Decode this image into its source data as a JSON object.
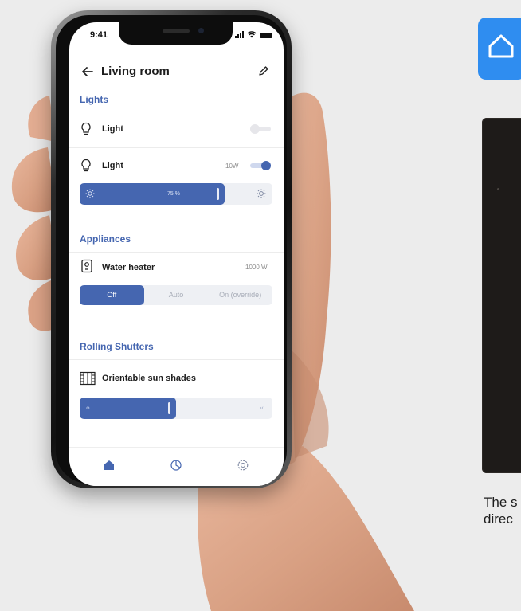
{
  "status_bar": {
    "time": "9:41"
  },
  "header": {
    "title": "Living room",
    "back_icon": "arrow-left-icon",
    "edit_icon": "pencil-icon"
  },
  "lights": {
    "section_title": "Lights",
    "items": [
      {
        "label": "Light",
        "on": false
      },
      {
        "label": "Light",
        "power": "10W",
        "on": true,
        "brightness_label": "75 %",
        "brightness_fraction": 0.75
      }
    ]
  },
  "appliances": {
    "section_title": "Appliances",
    "item": {
      "label": "Water heater",
      "power": "1000 W"
    },
    "modes": [
      "Off",
      "Auto",
      "On (override)"
    ],
    "selected_mode": "Off"
  },
  "shutters": {
    "section_title": "Rolling Shutters",
    "item": {
      "label": "Orientable sun shades"
    },
    "open_icon": "‹›",
    "close_icon": "›‹",
    "position_fraction": 0.5
  },
  "tabs": [
    {
      "name": "home",
      "active": true
    },
    {
      "name": "energy",
      "active": false
    },
    {
      "name": "settings",
      "active": false
    }
  ],
  "colors": {
    "accent": "#4566b0",
    "brand": "#2f8df0",
    "panel": "#1e1b19"
  },
  "caption": {
    "line1": "The s",
    "line2": "direc"
  }
}
